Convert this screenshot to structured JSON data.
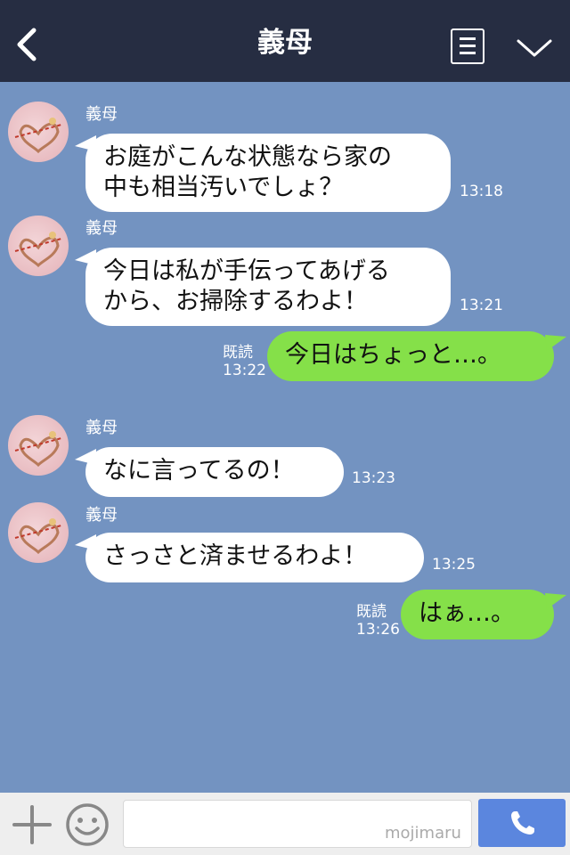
{
  "header": {
    "title": "義母"
  },
  "messages": [
    {
      "sender": "義母",
      "lines": [
        "お庭がこんな状態なら家の",
        "中も相当汚いでしょ？"
      ],
      "time": "13:18"
    },
    {
      "sender": "義母",
      "lines": [
        "今日は私が手伝ってあげる",
        "から、お掃除するわよ！"
      ],
      "time": "13:21"
    },
    {
      "read": "既読",
      "time": "13:22",
      "text": "今日はちょっと…。"
    },
    {
      "sender": "義母",
      "text": "なに言ってるの！",
      "time": "13:23"
    },
    {
      "sender": "義母",
      "text": "さっさと済ませるわよ！",
      "time": "13:25"
    },
    {
      "read": "既読",
      "time": "13:26",
      "text": "はぁ…。"
    }
  ],
  "input": {
    "watermark": "mojimaru"
  },
  "colors": {
    "header_bg": "#262d42",
    "chat_bg": "#7393c1",
    "incoming": "#ffffff",
    "outgoing": "#85e049",
    "call_button": "#5b86de"
  },
  "icons": [
    "back-icon",
    "menu-icon",
    "chevron-down-icon",
    "plus-icon",
    "smile-icon",
    "phone-icon"
  ]
}
